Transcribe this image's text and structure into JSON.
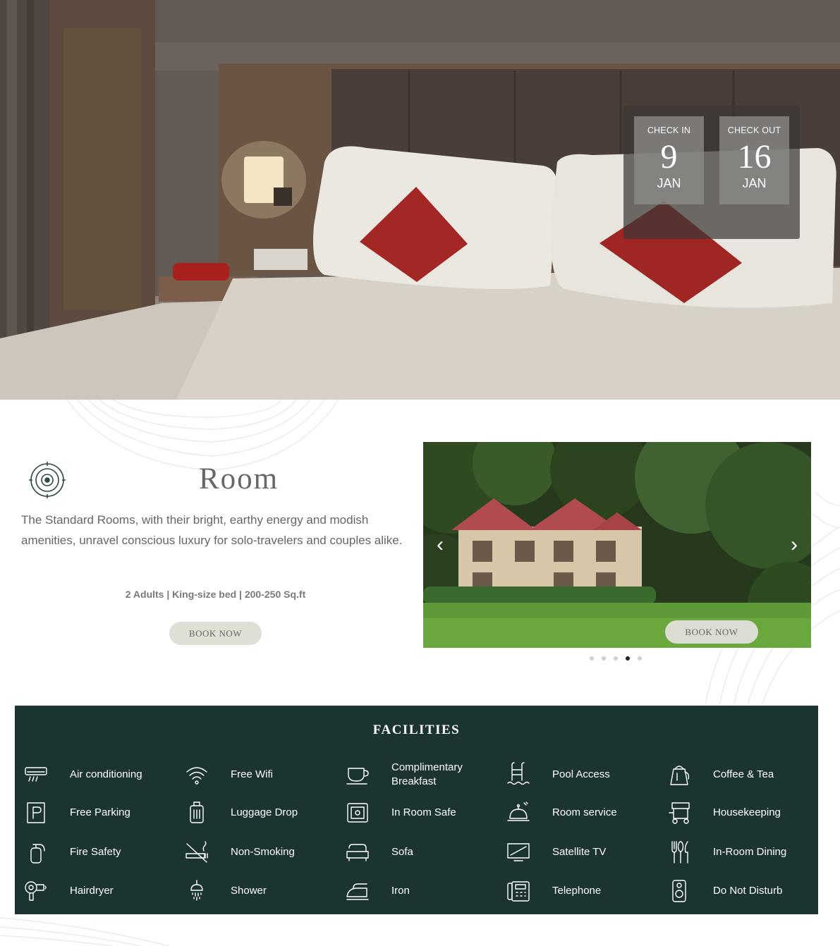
{
  "booking": {
    "check_in": {
      "label": "CHECK IN",
      "day": "9",
      "month": "JAN"
    },
    "check_out": {
      "label": "CHECK OUT",
      "day": "16",
      "month": "JAN"
    }
  },
  "room": {
    "title": "Room",
    "description": "The Standard Rooms, with their bright, earthy energy and modish amenities, unravel conscious luxury for solo-travelers and couples alike.",
    "specs": "2 Adults | King-size bed | 200-250 Sq.ft",
    "book_label": "BOOK NOW"
  },
  "carousel": {
    "book_label": "BOOK NOW",
    "slide_count": 5,
    "active_index": 3
  },
  "facilities": {
    "title": "FACILITIES",
    "items": [
      {
        "label": "Air conditioning",
        "icon": "air-conditioner-icon"
      },
      {
        "label": "Free Wifi",
        "icon": "wifi-icon"
      },
      {
        "label": "Complimentary Breakfast",
        "icon": "coffee-cup-icon"
      },
      {
        "label": "Pool Access",
        "icon": "pool-ladder-icon"
      },
      {
        "label": "Coffee & Tea",
        "icon": "kettle-icon"
      },
      {
        "label": "Free Parking",
        "icon": "parking-icon"
      },
      {
        "label": "Luggage Drop",
        "icon": "luggage-icon"
      },
      {
        "label": "In Room Safe",
        "icon": "safe-icon"
      },
      {
        "label": "Room service",
        "icon": "service-bell-icon"
      },
      {
        "label": "Housekeeping",
        "icon": "housekeeping-cart-icon"
      },
      {
        "label": "Fire Safety",
        "icon": "fire-extinguisher-icon"
      },
      {
        "label": "Non-Smoking",
        "icon": "no-smoking-icon"
      },
      {
        "label": "Sofa",
        "icon": "sofa-icon"
      },
      {
        "label": "Satellite TV",
        "icon": "tv-icon"
      },
      {
        "label": "In-Room Dining",
        "icon": "cutlery-icon"
      },
      {
        "label": "Hairdryer",
        "icon": "hairdryer-icon"
      },
      {
        "label": "Shower",
        "icon": "shower-icon"
      },
      {
        "label": "Iron",
        "icon": "iron-icon"
      },
      {
        "label": "Telephone",
        "icon": "telephone-icon"
      },
      {
        "label": "Do Not Disturb",
        "icon": "door-hanger-icon"
      }
    ]
  },
  "colors": {
    "facilities_bg": "#1c3431",
    "button_bg": "#dfdfd6",
    "text_gray": "#666666"
  }
}
